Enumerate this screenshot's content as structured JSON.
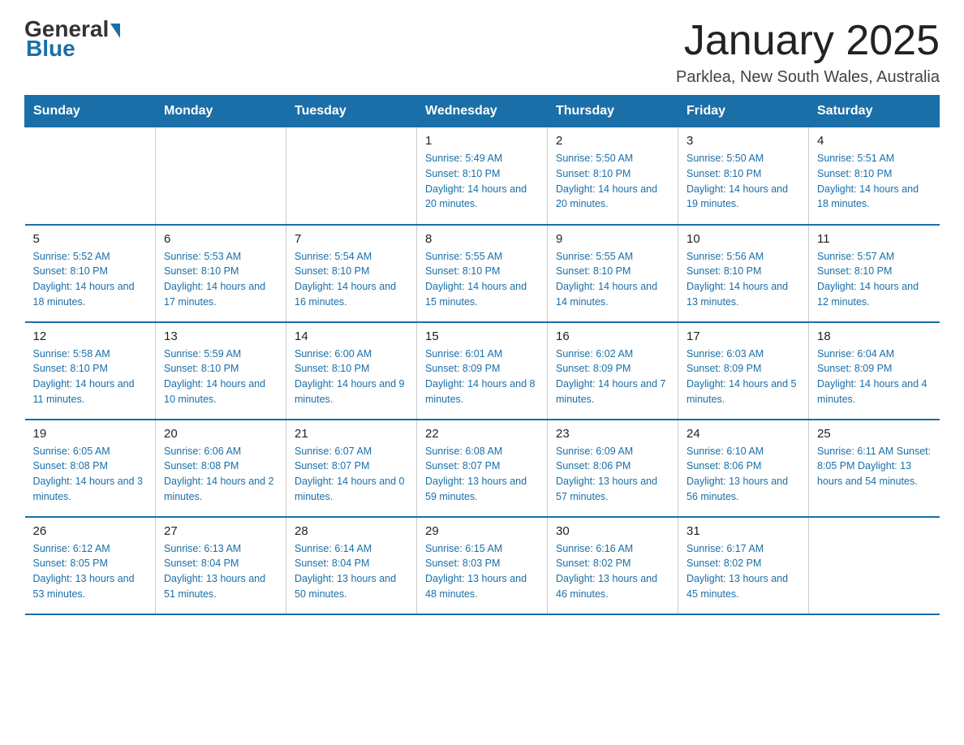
{
  "logo": {
    "general": "General",
    "blue": "Blue"
  },
  "title": "January 2025",
  "location": "Parklea, New South Wales, Australia",
  "days_of_week": [
    "Sunday",
    "Monday",
    "Tuesday",
    "Wednesday",
    "Thursday",
    "Friday",
    "Saturday"
  ],
  "weeks": [
    [
      {
        "day": "",
        "info": ""
      },
      {
        "day": "",
        "info": ""
      },
      {
        "day": "",
        "info": ""
      },
      {
        "day": "1",
        "info": "Sunrise: 5:49 AM\nSunset: 8:10 PM\nDaylight: 14 hours and 20 minutes."
      },
      {
        "day": "2",
        "info": "Sunrise: 5:50 AM\nSunset: 8:10 PM\nDaylight: 14 hours and 20 minutes."
      },
      {
        "day": "3",
        "info": "Sunrise: 5:50 AM\nSunset: 8:10 PM\nDaylight: 14 hours and 19 minutes."
      },
      {
        "day": "4",
        "info": "Sunrise: 5:51 AM\nSunset: 8:10 PM\nDaylight: 14 hours and 18 minutes."
      }
    ],
    [
      {
        "day": "5",
        "info": "Sunrise: 5:52 AM\nSunset: 8:10 PM\nDaylight: 14 hours and 18 minutes."
      },
      {
        "day": "6",
        "info": "Sunrise: 5:53 AM\nSunset: 8:10 PM\nDaylight: 14 hours and 17 minutes."
      },
      {
        "day": "7",
        "info": "Sunrise: 5:54 AM\nSunset: 8:10 PM\nDaylight: 14 hours and 16 minutes."
      },
      {
        "day": "8",
        "info": "Sunrise: 5:55 AM\nSunset: 8:10 PM\nDaylight: 14 hours and 15 minutes."
      },
      {
        "day": "9",
        "info": "Sunrise: 5:55 AM\nSunset: 8:10 PM\nDaylight: 14 hours and 14 minutes."
      },
      {
        "day": "10",
        "info": "Sunrise: 5:56 AM\nSunset: 8:10 PM\nDaylight: 14 hours and 13 minutes."
      },
      {
        "day": "11",
        "info": "Sunrise: 5:57 AM\nSunset: 8:10 PM\nDaylight: 14 hours and 12 minutes."
      }
    ],
    [
      {
        "day": "12",
        "info": "Sunrise: 5:58 AM\nSunset: 8:10 PM\nDaylight: 14 hours and 11 minutes."
      },
      {
        "day": "13",
        "info": "Sunrise: 5:59 AM\nSunset: 8:10 PM\nDaylight: 14 hours and 10 minutes."
      },
      {
        "day": "14",
        "info": "Sunrise: 6:00 AM\nSunset: 8:10 PM\nDaylight: 14 hours and 9 minutes."
      },
      {
        "day": "15",
        "info": "Sunrise: 6:01 AM\nSunset: 8:09 PM\nDaylight: 14 hours and 8 minutes."
      },
      {
        "day": "16",
        "info": "Sunrise: 6:02 AM\nSunset: 8:09 PM\nDaylight: 14 hours and 7 minutes."
      },
      {
        "day": "17",
        "info": "Sunrise: 6:03 AM\nSunset: 8:09 PM\nDaylight: 14 hours and 5 minutes."
      },
      {
        "day": "18",
        "info": "Sunrise: 6:04 AM\nSunset: 8:09 PM\nDaylight: 14 hours and 4 minutes."
      }
    ],
    [
      {
        "day": "19",
        "info": "Sunrise: 6:05 AM\nSunset: 8:08 PM\nDaylight: 14 hours and 3 minutes."
      },
      {
        "day": "20",
        "info": "Sunrise: 6:06 AM\nSunset: 8:08 PM\nDaylight: 14 hours and 2 minutes."
      },
      {
        "day": "21",
        "info": "Sunrise: 6:07 AM\nSunset: 8:07 PM\nDaylight: 14 hours and 0 minutes."
      },
      {
        "day": "22",
        "info": "Sunrise: 6:08 AM\nSunset: 8:07 PM\nDaylight: 13 hours and 59 minutes."
      },
      {
        "day": "23",
        "info": "Sunrise: 6:09 AM\nSunset: 8:06 PM\nDaylight: 13 hours and 57 minutes."
      },
      {
        "day": "24",
        "info": "Sunrise: 6:10 AM\nSunset: 8:06 PM\nDaylight: 13 hours and 56 minutes."
      },
      {
        "day": "25",
        "info": "Sunrise: 6:11 AM\nSunset: 8:05 PM\nDaylight: 13 hours and 54 minutes."
      }
    ],
    [
      {
        "day": "26",
        "info": "Sunrise: 6:12 AM\nSunset: 8:05 PM\nDaylight: 13 hours and 53 minutes."
      },
      {
        "day": "27",
        "info": "Sunrise: 6:13 AM\nSunset: 8:04 PM\nDaylight: 13 hours and 51 minutes."
      },
      {
        "day": "28",
        "info": "Sunrise: 6:14 AM\nSunset: 8:04 PM\nDaylight: 13 hours and 50 minutes."
      },
      {
        "day": "29",
        "info": "Sunrise: 6:15 AM\nSunset: 8:03 PM\nDaylight: 13 hours and 48 minutes."
      },
      {
        "day": "30",
        "info": "Sunrise: 6:16 AM\nSunset: 8:02 PM\nDaylight: 13 hours and 46 minutes."
      },
      {
        "day": "31",
        "info": "Sunrise: 6:17 AM\nSunset: 8:02 PM\nDaylight: 13 hours and 45 minutes."
      },
      {
        "day": "",
        "info": ""
      }
    ]
  ]
}
